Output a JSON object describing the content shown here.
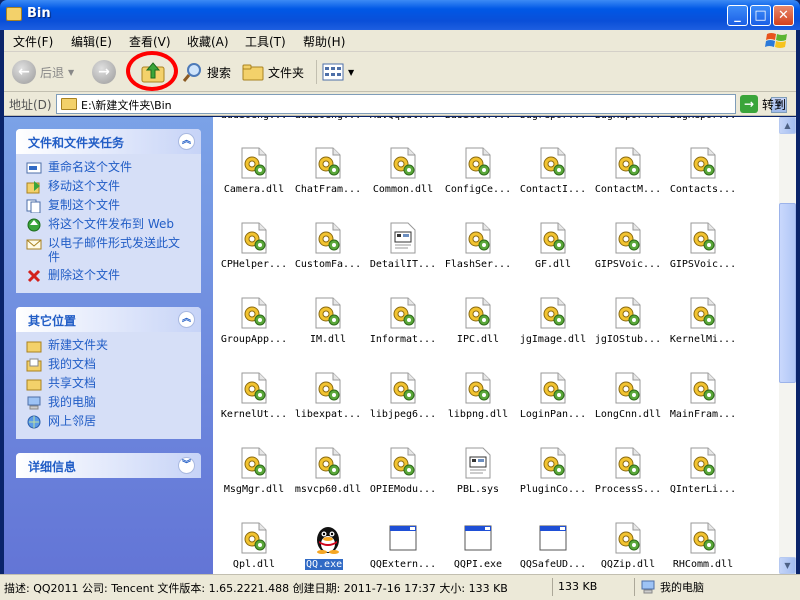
{
  "window": {
    "title": "Bin",
    "min_glyph": "_",
    "max_glyph": "□",
    "close_glyph": "✕"
  },
  "menu": {
    "items": [
      "文件(F)",
      "编辑(E)",
      "查看(V)",
      "收藏(A)",
      "工具(T)",
      "帮助(H)"
    ]
  },
  "toolbar": {
    "back_label": "后退",
    "search_label": "搜索",
    "folders_label": "文件夹"
  },
  "address": {
    "label": "地址(D)",
    "path": "E:\\新建文件夹\\Bin",
    "go_label": "转到"
  },
  "left_pane": {
    "tasks_panel": {
      "title": "文件和文件夹任务",
      "items": [
        "重命名这个文件",
        "移动这个文件",
        "复制这个文件",
        "将这个文件发布到 Web",
        "以电子邮件形式发送此文件",
        "删除这个文件"
      ]
    },
    "places_panel": {
      "title": "其它位置",
      "items": [
        "新建文件夹",
        "我的文档",
        "共享文档",
        "我的电脑",
        "网上邻居"
      ]
    },
    "details_panel": {
      "title": "详细信息"
    }
  },
  "files": {
    "top_cut_row": [
      "audioeng...",
      "audioeng...",
      "AdvQqsdl...",
      "BasicCtr...",
      "bugrepor...",
      "BugRepor...",
      "BugRepor..."
    ],
    "rows": [
      [
        "Camera.dll",
        "ChatFram...",
        "Common.dll",
        "ConfigCe...",
        "ContactI...",
        "ContactM...",
        "Contacts..."
      ],
      [
        "CPHelper...",
        "CustomFa...",
        "DetailIT...",
        "FlashSer...",
        "GF.dll",
        "GIPSVoic...",
        "GIPSVoic..."
      ],
      [
        "GroupApp...",
        "IM.dll",
        "Informat...",
        "IPC.dll",
        "jgImage.dll",
        "jgIOStub...",
        "KernelMi..."
      ],
      [
        "KernelUt...",
        "libexpat...",
        "libjpeg6...",
        "libpng.dll",
        "LoginPan...",
        "LongCnn.dll",
        "MainFram..."
      ],
      [
        "MsgMgr.dll",
        "msvcp60.dll",
        "OPIEModu...",
        "PBL.sys",
        "PluginCo...",
        "ProcessS...",
        "QInterLi..."
      ],
      [
        "Qpl.dll",
        "QQ.exe",
        "QQExtern...",
        "QQPI.exe",
        "QQSafeUD...",
        "QQZip.dll",
        "RHComm.dll"
      ]
    ],
    "icon_types": [
      [
        "dll",
        "dll",
        "dll",
        "dll",
        "dll",
        "dll",
        "dll"
      ],
      [
        "dll",
        "dll",
        "sys",
        "dll",
        "dll",
        "dll",
        "dll"
      ],
      [
        "dll",
        "dll",
        "dll",
        "dll",
        "dll",
        "dll",
        "dll"
      ],
      [
        "dll",
        "dll",
        "dll",
        "dll",
        "dll",
        "dll",
        "dll"
      ],
      [
        "dll",
        "dll",
        "dll",
        "sys",
        "dll",
        "dll",
        "dll"
      ],
      [
        "dll",
        "qq",
        "exe",
        "exe",
        "exe",
        "dll",
        "dll"
      ]
    ],
    "selected": "QQ.exe"
  },
  "status": {
    "main": "描述: QQ2011 公司: Tencent 文件版本: 1.65.2221.488 创建日期: 2011-7-16 17:37 大小: 133 KB",
    "size": "133 KB",
    "location": "我的电脑"
  },
  "colors": {
    "accent": "#0058e6",
    "task_link": "#215dc6",
    "annotation": "#ff0000"
  }
}
